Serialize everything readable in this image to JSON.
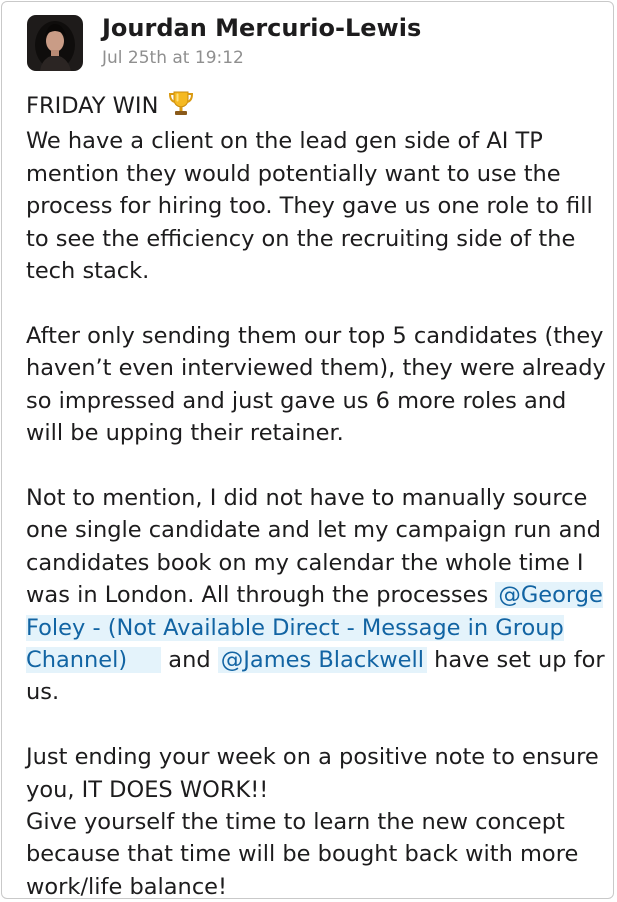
{
  "message": {
    "author": "Jourdan Mercurio-Lewis",
    "timestamp": "Jul 25th at 19:12",
    "avatar_icon": "profile-photo",
    "title_line": "FRIDAY WIN",
    "emoji_icon": "trophy-icon",
    "p1": "We have a client on the lead gen side of AI TP mention they would potentially want to use the process for hiring too. They gave us one role to fill to see the efficiency on the recruiting side of the tech stack.",
    "p2": "After only sending them our top 5 candidates (they haven’t even interviewed them), they were already so impressed and just gave us 6 more roles and will be upping their retainer.",
    "p3_pre": "Not to mention, I did not have to manually source one single candidate and let my campaign run and candidates book on my calendar the whole time I was in London. All through the processes ",
    "mention1": "@George Foley - (Not Available Direct - Message in Group Channel)",
    "p3_mid": " and ",
    "mention2": "@James Blackwell",
    "p3_post": "  have set up for us.",
    "p4": "Just ending your week on a positive note to ensure you, IT DOES WORK!!\nGive yourself the time to learn the new concept because that time will be bought back with more work/life balance!"
  },
  "colors": {
    "mention_bg": "#e4f3fb",
    "mention_text": "#1264a3",
    "text": "#1d1c1d",
    "timestamp": "#8f8f8f"
  }
}
